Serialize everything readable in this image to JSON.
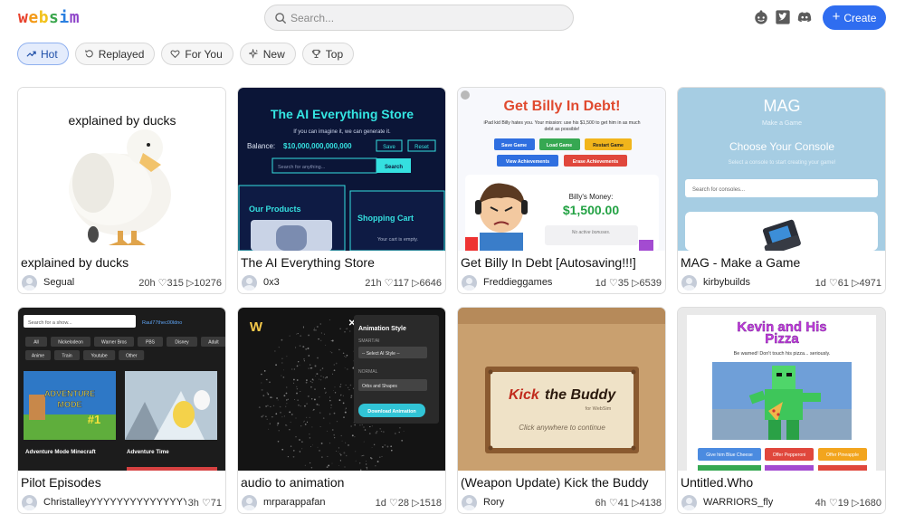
{
  "header": {
    "logo": "websim",
    "logo_colors": [
      "#e8412c",
      "#f39a18",
      "#f2c21b",
      "#3aa64c",
      "#2a7fe0",
      "#8e44c9"
    ],
    "search_placeholder": "Search...",
    "icons": [
      "reddit-icon",
      "twitter-icon",
      "discord-icon"
    ],
    "create_label": "Create",
    "accent": "#2f6df0"
  },
  "filters": [
    {
      "label": "Hot",
      "icon": "trending-icon",
      "active": true
    },
    {
      "label": "Replayed",
      "icon": "replay-icon",
      "active": false
    },
    {
      "label": "For You",
      "icon": "heart-icon",
      "active": false
    },
    {
      "label": "New",
      "icon": "sparkle-icon",
      "active": false
    },
    {
      "label": "Top",
      "icon": "trophy-icon",
      "active": false
    }
  ],
  "cards": [
    {
      "title": "explained by ducks",
      "author": "Segual",
      "stats": "20h ♡315 ▷10276",
      "thumb": {
        "heading": "explained by ducks"
      }
    },
    {
      "title": "The AI Everything Store",
      "author": "0x3",
      "stats": "21h ♡117 ▷6646",
      "thumb": {
        "heading": "The AI Everything Store",
        "sub": "If you can imagine it, we can generate it.",
        "balance_label": "Balance:",
        "balance": "$10,000,000,000,000",
        "save": "Save",
        "reset": "Reset",
        "search_placeholder": "Search for anything...",
        "search_btn": "Search",
        "products": "Our Products",
        "cart": "Shopping Cart",
        "cart_empty": "Your cart is empty."
      }
    },
    {
      "title": "Get Billy In Debt [Autosaving!!!]",
      "author": "Freddieggames",
      "stats": "1d ♡35 ▷6539",
      "thumb": {
        "heading": "Get Billy In Debt!",
        "sub": "iPad kid Billy hates you. Your mission: use his $1,500 to get him in as much debt as possible!",
        "buttons": [
          "Save Game",
          "Load Game",
          "Restart Game",
          "View Achievements",
          "Erase Achievements"
        ],
        "money_label": "Billy's Money:",
        "money": "$1,500.00",
        "bonus": "No active bonuses."
      }
    },
    {
      "title": "MAG - Make a Game",
      "author": "kirbybuilds",
      "stats": "1d ♡61 ▷4971",
      "thumb": {
        "heading": "MAG",
        "sub": "Make a Game",
        "choose": "Choose Your Console",
        "choose_sub": "Select a console to start creating your game!",
        "search_placeholder": "Search for consoles..."
      }
    },
    {
      "title": "Pilot Episodes",
      "author": "ChristalleyYYYYYYYYYYYYYYYY",
      "stats": "3h ♡71",
      "thumb": {
        "search_placeholder": "Search for a show...",
        "link": "Raul77thec00ldno",
        "tags": [
          "All",
          "Nickelodeon",
          "Warner Bros",
          "PBS",
          "Disney",
          "Adult",
          "Anime",
          "Train",
          "Youtube",
          "Other"
        ],
        "shows": [
          "Adventure Mode Minecraft",
          "Adventure Time"
        ],
        "badge_text": "ADVENTURE MODE #1"
      }
    },
    {
      "title": "audio to animation",
      "author": "mrparappafan",
      "stats": "1d ♡28 ▷1518",
      "thumb": {
        "panel_title": "Animation Style",
        "smart": "SMART/AI",
        "select_ai": "-- Select AI Style --",
        "normal": "NORMAL",
        "orbs": "Orbs and Shapes",
        "download": "Download Animation",
        "logo": "W"
      }
    },
    {
      "title": "(Weapon Update) Kick the Buddy",
      "author": "Rory",
      "stats": "6h ♡41 ▷4138",
      "thumb": {
        "kick": "Kick",
        "the_buddy": "the Buddy",
        "for": "for WebSim",
        "click": "Click anywhere to continue"
      }
    },
    {
      "title": "Untitled.Who",
      "author": "WARRIORS_fly",
      "stats": "4h ♡19 ▷1680",
      "thumb": {
        "heading_1": "Kevin and His",
        "heading_2": "Pizza",
        "warning": "Be warned! Don't touch his pizza... seriously.",
        "buttons": [
          "Give him Blue Cheese",
          "Offer Pepperoni",
          "Offer Pineapple"
        ]
      }
    }
  ]
}
